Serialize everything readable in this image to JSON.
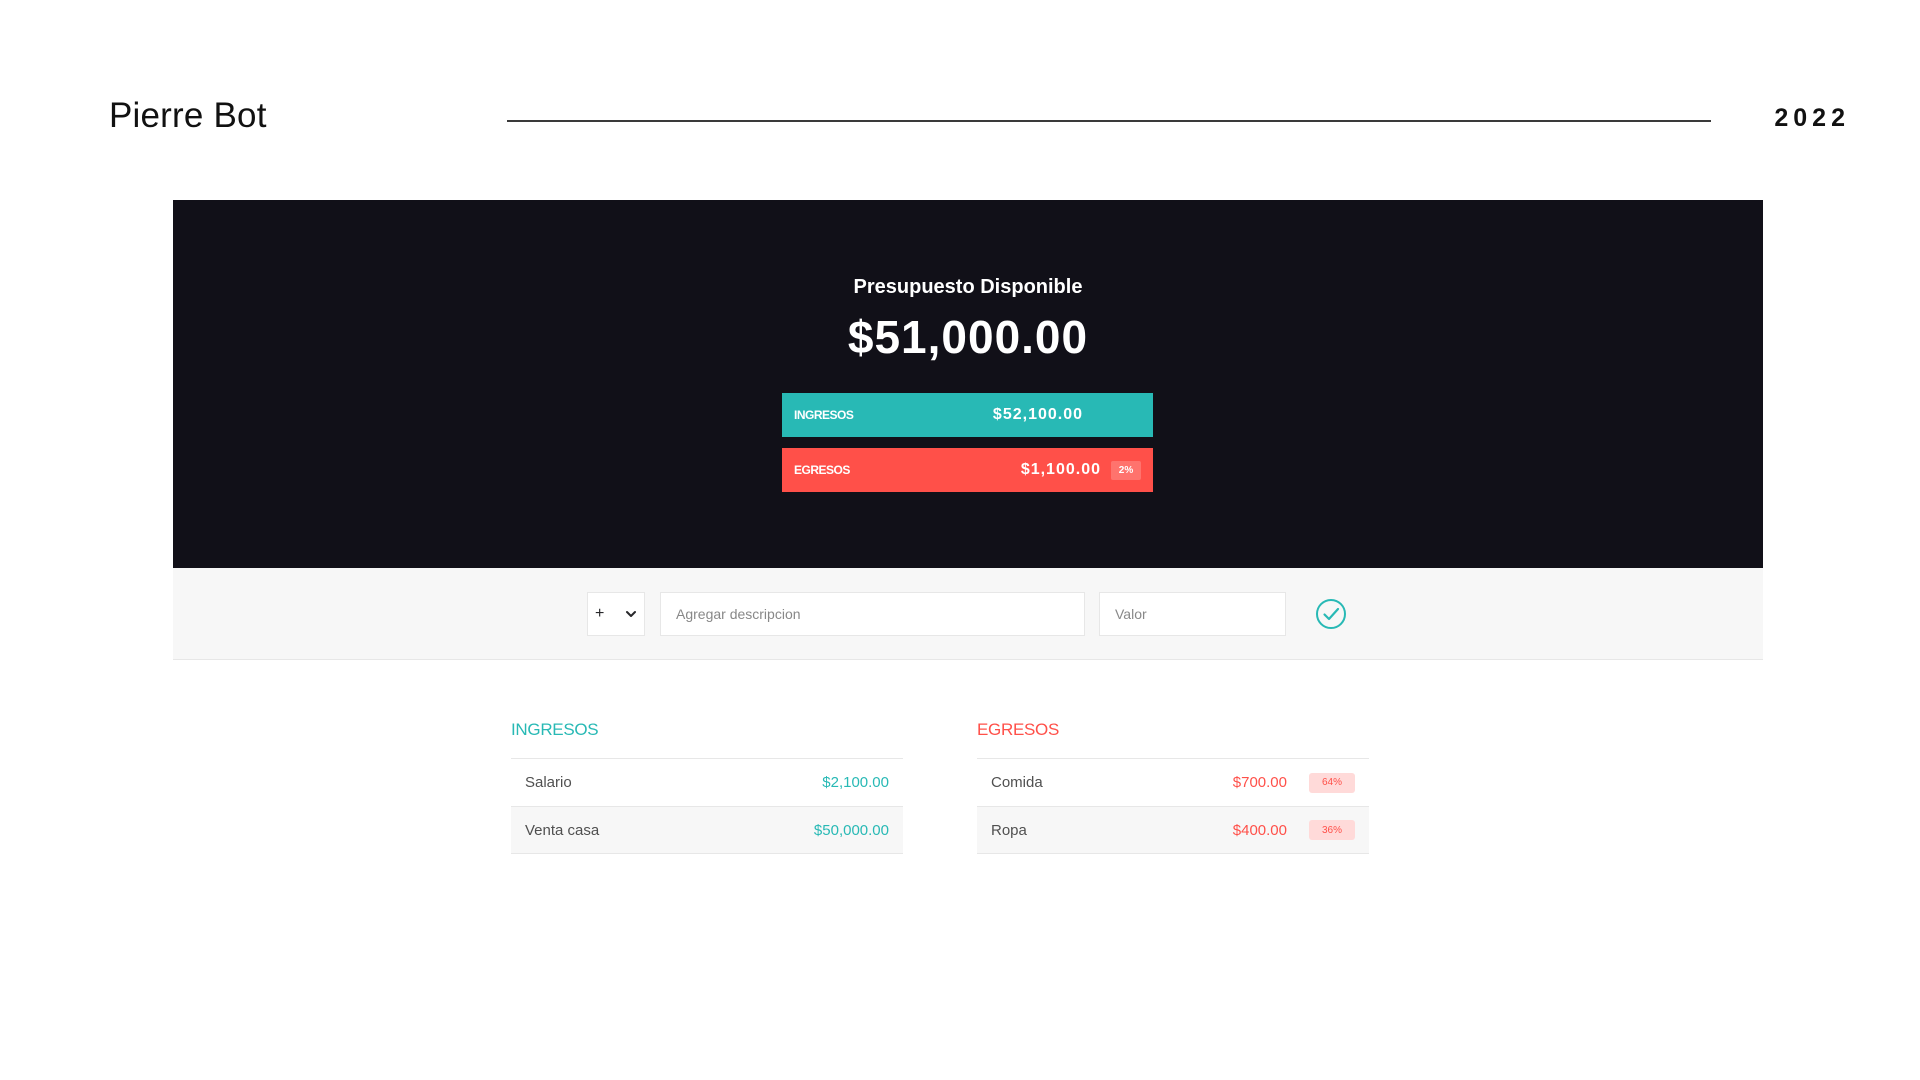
{
  "slide": {
    "author": "Pierre Bot",
    "year": "2022"
  },
  "budget": {
    "title": "Presupuesto Disponible",
    "value": "$51,000.00",
    "income": {
      "label": "Ingresos",
      "value": "$52,100.00"
    },
    "expense": {
      "label": "Egresos",
      "value": "$1,100.00",
      "percent": "2%"
    }
  },
  "add_form": {
    "type_value": "+",
    "description_placeholder": "Agregar descripcion",
    "value_placeholder": "Valor",
    "submit_icon": "check-circle-icon"
  },
  "income_list": {
    "title": "Ingresos",
    "items": [
      {
        "description": "Salario",
        "value": "$2,100.00"
      },
      {
        "description": "Venta casa",
        "value": "$50,000.00"
      }
    ]
  },
  "expense_list": {
    "title": "Egresos",
    "items": [
      {
        "description": "Comida",
        "value": "$700.00",
        "percent": "64%"
      },
      {
        "description": "Ropa",
        "value": "$400.00",
        "percent": "36%"
      }
    ]
  },
  "colors": {
    "income": "#28b9b5",
    "expense": "#ff5049",
    "header_bg": "#111018"
  }
}
